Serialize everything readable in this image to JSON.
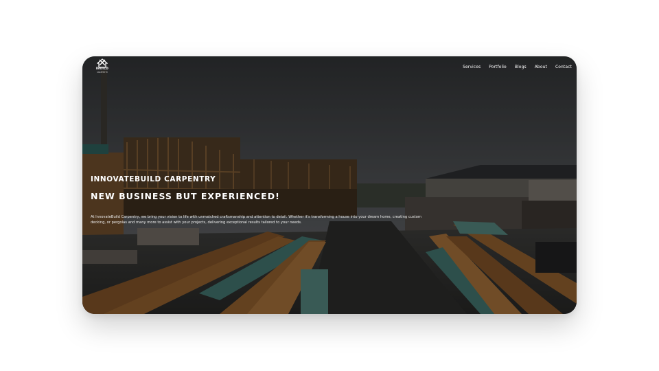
{
  "brand": {
    "name": "IBUILD",
    "tagline": "CARPENTRY"
  },
  "nav": {
    "items": [
      "Services",
      "Portfolio",
      "Blogs",
      "About",
      "Contact"
    ]
  },
  "hero": {
    "kicker": "INNOVATEBUILD CARPENTRY",
    "title": "NEW BUSINESS BUT EXPERIENCED!",
    "body": "At InnovateBuild Carpentry, we bring your vision to life with unmatched craftsmanship and attention to detail. Whether it's transforming a house into your dream home, creating custom decking, or pergolas and many more to assist with your projects, delivering exceptional results tailored to your needs."
  },
  "colors": {
    "overlay": "#3e4043",
    "text": "#ffffff",
    "timber": "#8a5a2c",
    "teal_timber": "#3f6e68"
  },
  "icons": {
    "logo": "house-hammer-logo-icon"
  }
}
